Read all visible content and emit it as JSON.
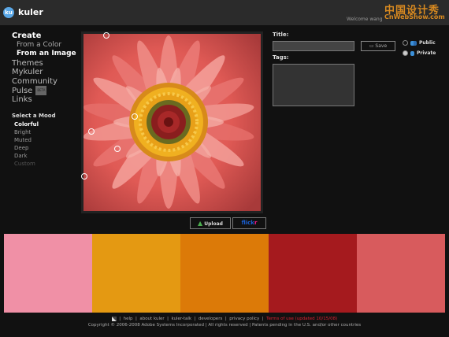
{
  "header": {
    "logo_initials": "ku",
    "app_name": "kuler",
    "welcome": "Welcome wang"
  },
  "watermark": {
    "cn": "中国设计秀",
    "site": "CnWebShow.com"
  },
  "nav": {
    "create": "Create",
    "from_color": "From a Color",
    "from_image": "From an Image",
    "themes": "Themes",
    "mykuler": "Mykuler",
    "community": "Community",
    "pulse": "Pulse",
    "beta": "BETA",
    "links": "Links"
  },
  "mood": {
    "heading": "Select a Mood",
    "options": [
      "Colorful",
      "Bright",
      "Muted",
      "Deep",
      "Dark",
      "Custom"
    ]
  },
  "buttons": {
    "upload": "Upload",
    "flickr_a": "flick",
    "flickr_b": "r",
    "save": "Save"
  },
  "form": {
    "title_label": "Title:",
    "tags_label": "Tags:",
    "title_value": "",
    "tags_value": ""
  },
  "visibility": {
    "public": "Public",
    "private": "Private",
    "selected": "Private"
  },
  "palette": [
    "#f090a6",
    "#e49912",
    "#dc7a08",
    "#a51a1e",
    "#d85b5d"
  ],
  "footer": {
    "links": [
      "help",
      "about kuler",
      "kuler-talk",
      "developers",
      "privacy policy"
    ],
    "terms": "Terms of use (updated 10/15/08)",
    "copyright": "Copyright © 2006-2008 Adobe Systems Incorporated | All rights reserved | Patents pending in the U.S. and/or other countries"
  }
}
